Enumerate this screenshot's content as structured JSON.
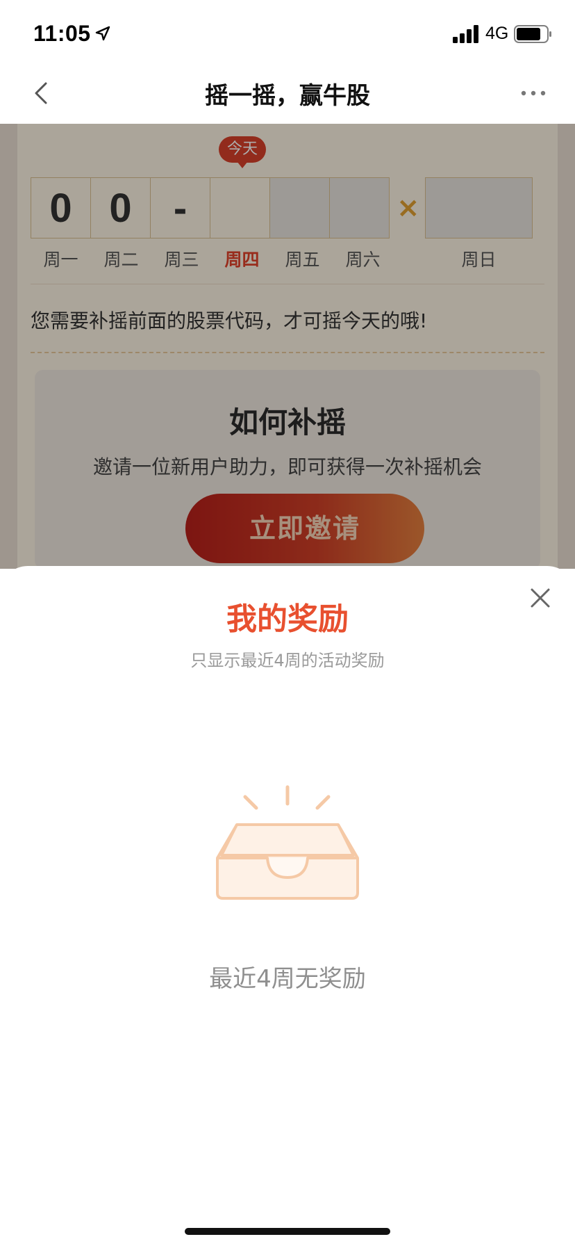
{
  "status_bar": {
    "time": "11:05",
    "network": "4G",
    "icons": [
      "location-arrow-icon",
      "signal-bars-icon",
      "battery-icon"
    ]
  },
  "nav": {
    "title": "摇一摇，赢牛股",
    "icons": [
      "back-chevron-icon",
      "more-dots-icon"
    ]
  },
  "calendar": {
    "today_badge": "今天",
    "boxes": [
      "0",
      "0",
      "-",
      "",
      "",
      ""
    ],
    "cross": "×",
    "days": [
      "周一",
      "周二",
      "周三",
      "周四",
      "周五",
      "周六"
    ],
    "sunday": "周日",
    "today_index": 3
  },
  "notice": "您需要补摇前面的股票代码，才可摇今天的哦!",
  "howto": {
    "title": "如何补摇",
    "desc": "邀请一位新用户助力，即可获得一次补摇机会",
    "button": "立即邀请"
  },
  "sheet": {
    "title": "我的奖励",
    "subtitle": "只显示最近4周的活动奖励",
    "empty_text": "最近4周无奖励",
    "icons": [
      "close-icon",
      "empty-inbox-icon"
    ]
  },
  "colors": {
    "accent": "#e8502f",
    "badge": "#d8402a",
    "gold": "#e0a032"
  }
}
